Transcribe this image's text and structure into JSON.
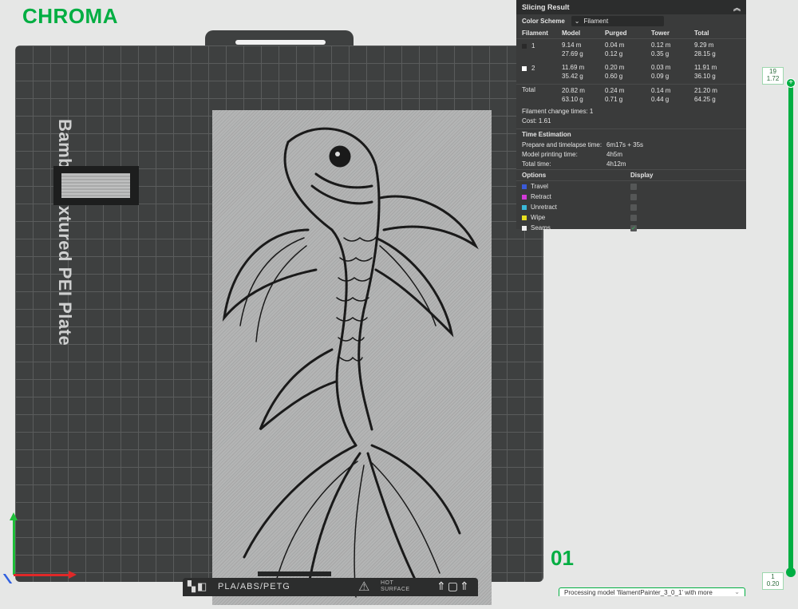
{
  "brand": {
    "logo": "CHROMA"
  },
  "plate": {
    "title": "Bambu Textured PEI Plate",
    "number": "01",
    "material_label": "PLA/ABS/PETG",
    "surface_label_1": "HOT",
    "surface_label_2": "SURFACE"
  },
  "slicing": {
    "title": "Slicing Result",
    "color_scheme_label": "Color Scheme",
    "color_scheme_value": "Filament",
    "headers": [
      "Filament",
      "Model",
      "Purged",
      "Tower",
      "Total"
    ],
    "rows": [
      {
        "id": "1",
        "color": "#2a2a2a",
        "model_m": "9.14 m",
        "model_g": "27.69 g",
        "purged_m": "0.04 m",
        "purged_g": "0.12 g",
        "tower_m": "0.12 m",
        "tower_g": "0.35 g",
        "total_m": "9.29 m",
        "total_g": "28.15 g"
      },
      {
        "id": "2",
        "color": "#ffffff",
        "model_m": "11.69 m",
        "model_g": "35.42 g",
        "purged_m": "0.20 m",
        "purged_g": "0.60 g",
        "tower_m": "0.03 m",
        "tower_g": "0.09 g",
        "total_m": "11.91 m",
        "total_g": "36.10 g"
      }
    ],
    "total": {
      "label": "Total",
      "model_m": "20.82 m",
      "model_g": "63.10 g",
      "purged_m": "0.24 m",
      "purged_g": "0.71 g",
      "tower_m": "0.14 m",
      "tower_g": "0.44 g",
      "total_m": "21.20 m",
      "total_g": "64.25 g"
    },
    "filament_change": "Filament change times:   1",
    "cost": "Cost:   1.61",
    "time_title": "Time Estimation",
    "times": [
      {
        "label": "Prepare and timelapse time:",
        "value": "6m17s + 35s"
      },
      {
        "label": "Model printing time:",
        "value": "4h5m"
      },
      {
        "label": "Total time:",
        "value": "4h12m"
      }
    ],
    "options_label": "Options",
    "display_label": "Display",
    "options": [
      {
        "label": "Travel",
        "color": "#3a5ad8",
        "checked": false
      },
      {
        "label": "Retract",
        "color": "#d43ad8",
        "checked": false
      },
      {
        "label": "Unretract",
        "color": "#3ab8d8",
        "checked": false
      },
      {
        "label": "Wipe",
        "color": "#e8e020",
        "checked": false
      },
      {
        "label": "Seams",
        "color": "#f0f0f0",
        "checked": true
      }
    ]
  },
  "slider": {
    "top_layer": "19",
    "top_height": "1.72",
    "bottom_layer": "1",
    "bottom_height": "0.20"
  },
  "notice": {
    "text": "Processing model 'filamentPainter_3_0_1' with more"
  }
}
